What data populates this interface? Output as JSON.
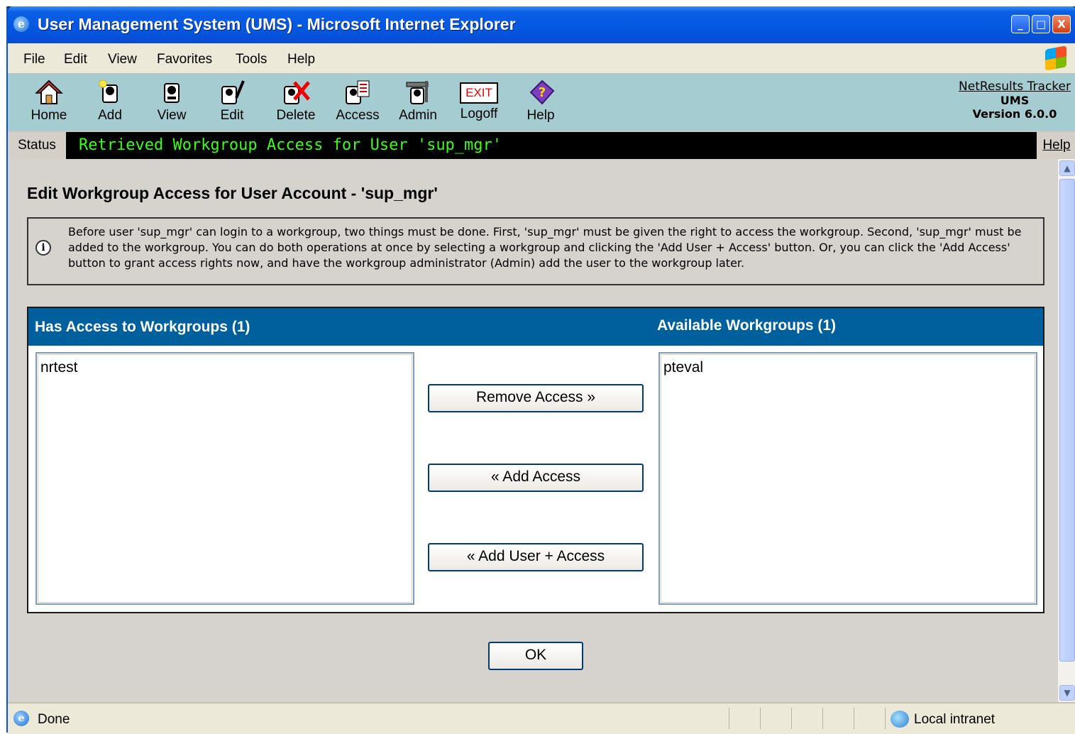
{
  "window": {
    "title": "User Management System (UMS) - Microsoft Internet Explorer",
    "buttons": {
      "minimize": "_",
      "maximize": "□",
      "close": "X"
    }
  },
  "menu": [
    "File",
    "Edit",
    "View",
    "Favorites",
    "Tools",
    "Help"
  ],
  "toolbar": {
    "items": [
      {
        "label": "Home",
        "icon": "home-icon"
      },
      {
        "label": "Add",
        "icon": "add-user-icon"
      },
      {
        "label": "View",
        "icon": "view-user-icon"
      },
      {
        "label": "Edit",
        "icon": "edit-user-icon"
      },
      {
        "label": "Delete",
        "icon": "delete-user-icon"
      },
      {
        "label": "Access",
        "icon": "access-icon"
      },
      {
        "label": "Admin",
        "icon": "admin-icon"
      },
      {
        "label": "Logoff",
        "icon": "exit-icon"
      },
      {
        "label": "Help",
        "icon": "help-book-icon"
      }
    ],
    "exit_text": "EXIT",
    "brand": {
      "line1": "NetResults Tracker",
      "line2": "UMS",
      "line3": "Version 6.0.0"
    }
  },
  "status": {
    "label": "Status",
    "message": "Retrieved Workgroup Access for User 'sup_mgr'",
    "help": "Help"
  },
  "page": {
    "heading": "Edit Workgroup Access for User Account - 'sup_mgr'",
    "info": "Before user 'sup_mgr' can login to a workgroup, two things must be done. First, 'sup_mgr' must be given the right to access the workgroup. Second, 'sup_mgr' must be added to the workgroup. You can do both operations at once by selecting a workgroup and clicking the 'Add User + Access' button. Or, you can click the 'Add Access' button to grant access rights now, and have the workgroup administrator (Admin) add the user to the workgroup later.",
    "has_access_title": "Has Access to Workgroups (1)",
    "available_title": "Available Workgroups (1)",
    "has_access_items": [
      "nrtest"
    ],
    "available_items": [
      "pteval"
    ],
    "buttons": {
      "remove": "Remove Access »",
      "add": "« Add Access",
      "add_user": "« Add User + Access",
      "ok": "OK"
    }
  },
  "statusbar": {
    "done": "Done",
    "zone": "Local intranet"
  },
  "colors": {
    "accent": "#00609d",
    "status_text": "#39ff14",
    "toolbar_bg": "#a4ccd1"
  }
}
